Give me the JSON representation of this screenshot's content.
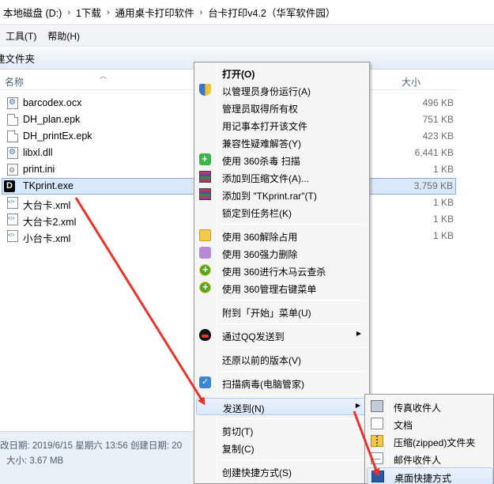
{
  "address": {
    "crumbs": [
      "本地磁盘 (D:)",
      "1下载",
      "通用桌卡打印软件",
      "台卡打印v4.2（华军软件园）"
    ]
  },
  "menubar": {
    "items": [
      "工具(T)",
      "帮助(H)"
    ]
  },
  "toolbar": {
    "new_folder": "建文件夹"
  },
  "columns": {
    "name": "名称",
    "size": "大小"
  },
  "files": [
    {
      "name": "barcodex.ocx",
      "size": "496 KB",
      "icon": "gear-file-icon"
    },
    {
      "name": "DH_plan.epk",
      "size": "751 KB",
      "icon": "document-icon"
    },
    {
      "name": "DH_printEx.epk",
      "size": "423 KB",
      "icon": "document-icon"
    },
    {
      "name": "libxl.dll",
      "size": "6,441 KB",
      "icon": "gear-file-icon"
    },
    {
      "name": "print.ini",
      "size": "1 KB",
      "icon": "settings-file-icon"
    },
    {
      "name": "TKprint.exe",
      "size": "3,759 KB",
      "icon": "app-icon",
      "selected": true
    },
    {
      "name": "大台卡.xml",
      "size": "1 KB",
      "icon": "xml-file-icon"
    },
    {
      "name": "大台卡2.xml",
      "size": "1 KB",
      "icon": "xml-file-icon"
    },
    {
      "name": "小台卡.xml",
      "size": "1 KB",
      "icon": "xml-file-icon"
    }
  ],
  "details": {
    "line1": "改日期: 2019/6/15 星期六 13:56 创建日期: 20",
    "line2": "大小: 3.67 MB"
  },
  "context_menu": {
    "open": "打开(O)",
    "run_as_admin": "以管理员身份运行(A)",
    "take_ownership": "管理员取得所有权",
    "open_notepad": "用记事本打开该文件",
    "troubleshoot": "兼容性疑难解答(Y)",
    "scan_360": "使用 360杀毒 扫描",
    "add_archive": "添加到压缩文件(A)...",
    "add_rar": "添加到 \"TKprint.rar\"(T)",
    "pin_taskbar": "锁定到任务栏(K)",
    "unlock_360": "使用 360解除占用",
    "force_delete_360": "使用 360强力删除",
    "trojan_scan_360": "使用 360进行木马云查杀",
    "manage_menu_360": "使用 360管理右键菜单",
    "pin_start": "附到「开始」菜单(U)",
    "send_qq": "通过QQ发送到",
    "restore_versions": "还原以前的版本(V)",
    "scan_virus": "扫描病毒(电脑管家)",
    "send_to": "发送到(N)",
    "cut": "剪切(T)",
    "copy": "复制(C)",
    "create_shortcut": "创建快捷方式(S)"
  },
  "send_to_menu": {
    "fax": "传真收件人",
    "documents": "文档",
    "zip": "压缩(zipped)文件夹",
    "mail": "邮件收件人",
    "desktop": "桌面快捷方式"
  },
  "colors": {
    "arrow": "#e8332a",
    "selection": "#d9e8fb",
    "highlight": "#dce9fa"
  }
}
